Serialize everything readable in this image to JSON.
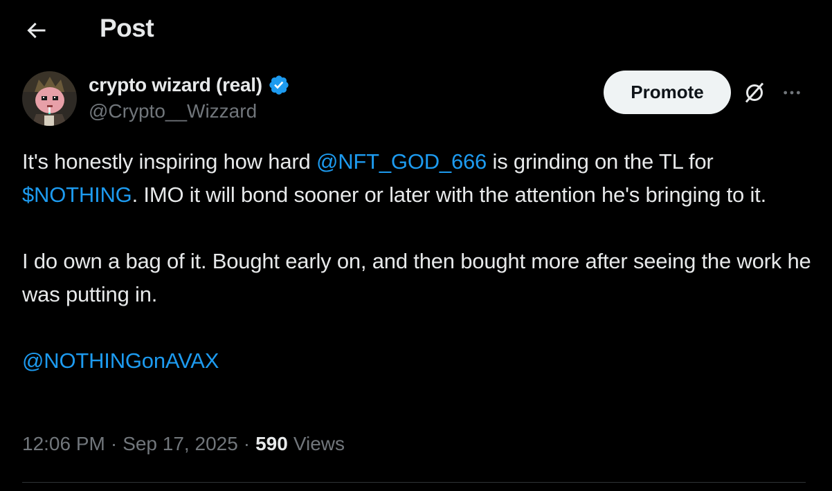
{
  "header": {
    "title": "Post",
    "back_icon": "arrow-left-icon"
  },
  "author": {
    "display_name": "crypto wizard (real)",
    "handle": "@Crypto__Wizzard",
    "verified": true,
    "avatar_icon": "avatar-pixel-wizard"
  },
  "actions": {
    "promote_label": "Promote",
    "grok_icon": "grok-slash-icon",
    "more_icon": "more-dots-icon"
  },
  "tweet": {
    "line1_pre": "It's honestly inspiring how hard ",
    "mention1": "@NFT_GOD_666",
    "line1_post": " is grinding on the TL for",
    "cashtag": "$NOTHING",
    "line2_post": ". IMO it will bond sooner or later with the attention he's bringing to it.",
    "paragraph2": "I do own a bag of it. Bought early on, and then bought more after seeing the work he was putting in.",
    "mention2": "@NOTHINGonAVAX"
  },
  "meta": {
    "time": "12:06 PM",
    "date": "Sep 17, 2025",
    "views_count": "590",
    "views_label": "Views",
    "separator": "·"
  },
  "colors": {
    "background": "#000000",
    "text": "#e7e9ea",
    "muted": "#71767b",
    "link": "#1d9bf0",
    "divider": "#2f3336"
  }
}
